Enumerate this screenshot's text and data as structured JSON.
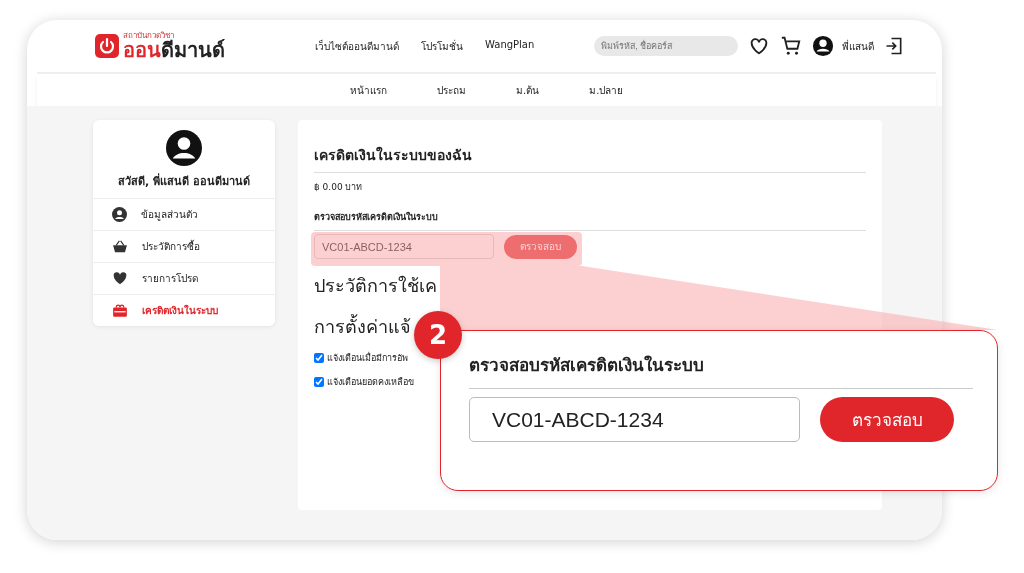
{
  "header": {
    "logo": {
      "tagline": "สถาบันกวดวิชา",
      "name_red": "ออน",
      "name_dark": "ดีมานด์"
    },
    "nav": [
      "เว็บไซต์ออนดีมานด์",
      "โปรโมชั่น",
      "WangPlan"
    ],
    "search": {
      "placeholder": "พิมพ์รหัส, ชื่อคอร์ส"
    },
    "user_name": "พี่แสนดี"
  },
  "subnav": [
    "หน้าแรก",
    "ประถม",
    "ม.ต้น",
    "ม.ปลาย"
  ],
  "sidebar": {
    "greeting": "สวัสดี, พี่แสนดี ออนดีมานด์",
    "items": [
      {
        "label": "ข้อมูลส่วนตัว",
        "kind": "profile",
        "selected": false
      },
      {
        "label": "ประวัติการซื้อ",
        "kind": "basket",
        "selected": false
      },
      {
        "label": "รายการโปรด",
        "kind": "heart",
        "selected": false
      },
      {
        "label": "เครดิตเงินในระบบ",
        "kind": "gift",
        "selected": true
      }
    ]
  },
  "main": {
    "title": "เครดิตเงินในระบบของฉัน",
    "balance": "฿ 0.00 บาท",
    "check_label": "ตรวจสอบรหัสเครดิตเงินในระบบ",
    "code_value": "VC01-ABCD-1234",
    "check_button": "ตรวจสอบ",
    "history_heading": "ประวัติการใช้เค",
    "settings_heading": "การตั้งค่าแจ้",
    "options": [
      {
        "label": "แจ้งเตือนเมื่อมีการอัพ",
        "checked": true
      },
      {
        "label": "แจ้งเตือนยอดคงเหลือข",
        "checked": true
      }
    ]
  },
  "callout": {
    "step": "2",
    "title": "ตรวจสอบรหัสเครดิตเงินในระบบ",
    "code_value": "VC01-ABCD-1234",
    "button": "ตรวจสอบ"
  }
}
